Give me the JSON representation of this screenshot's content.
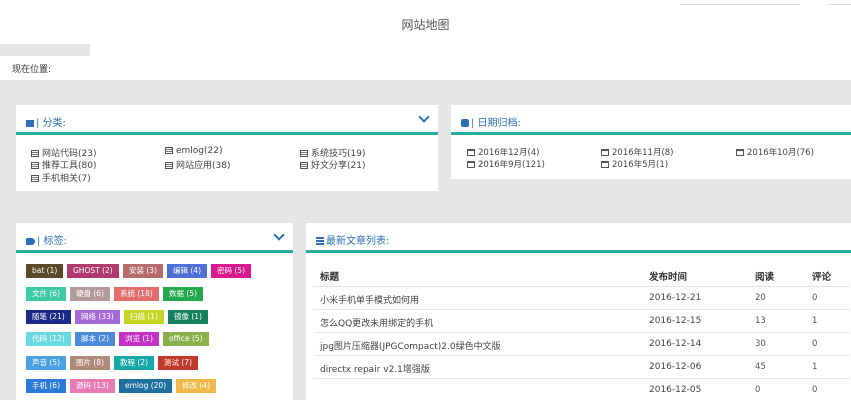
{
  "header": {
    "title": "网站地图"
  },
  "location": {
    "label": "现在位置:"
  },
  "categories_panel": {
    "title": "| 分类:",
    "items": [
      "网站代码(23)",
      "emlog(22)",
      "系统技巧(19)",
      "推荐工具(80)",
      "网站应用(38)",
      "好文分享(21)",
      "手机相关(7)"
    ]
  },
  "archive_panel": {
    "title": "| 日期归档:",
    "items": [
      "2016年12月(4)",
      "2016年11月(8)",
      "2016年10月(76)",
      "2016年9月(121)",
      "2016年5月(1)"
    ]
  },
  "tags_panel": {
    "title": "| 标签:",
    "tags": [
      {
        "label": "bat (1)",
        "color": "#5a4a2a"
      },
      {
        "label": "GHOST (2)",
        "color": "#b03a6e"
      },
      {
        "label": "安装 (3)",
        "color": "#b76b6b"
      },
      {
        "label": "编辑 (4)",
        "color": "#4f6fd8"
      },
      {
        "label": "密码 (5)",
        "color": "#d91a8e"
      },
      {
        "label": "文件 (6)",
        "color": "#3fc8a4"
      },
      {
        "label": "硬盘 (6)",
        "color": "#b59a9a"
      },
      {
        "label": "系统 (18)",
        "color": "#e36c6c"
      },
      {
        "label": "数据 (5)",
        "color": "#23a84e"
      },
      {
        "label": "随笔 (21)",
        "color": "#1b2a8a"
      },
      {
        "label": "网络 (33)",
        "color": "#a56ad8"
      },
      {
        "label": "扫描 (1)",
        "color": "#c6d424"
      },
      {
        "label": "镜像 (1)",
        "color": "#17805e"
      },
      {
        "label": "代码 (12)",
        "color": "#6ad8e0"
      },
      {
        "label": "脚本 (2)",
        "color": "#4a8ad8"
      },
      {
        "label": "浏览 (1)",
        "color": "#c431c4"
      },
      {
        "label": "office (5)",
        "color": "#8ab04a"
      },
      {
        "label": "声音 (5)",
        "color": "#4aa0e0"
      },
      {
        "label": "图片 (8)",
        "color": "#b08a7a"
      },
      {
        "label": "教程 (2)",
        "color": "#17a8a8"
      },
      {
        "label": "测试 (7)",
        "color": "#c0392b"
      },
      {
        "label": "手机 (6)",
        "color": "#2a7ad8"
      },
      {
        "label": "源码 (13)",
        "color": "#e87ab4"
      },
      {
        "label": "emlog (20)",
        "color": "#1f6fa0"
      },
      {
        "label": "修改 (4)",
        "color": "#f0b84a"
      }
    ]
  },
  "articles_panel": {
    "title": "最新文章列表:",
    "columns": [
      "标题",
      "发布时间",
      "阅读",
      "评论"
    ],
    "rows": [
      {
        "title": "小米手机单手模式如何用",
        "date": "2016-12-21",
        "reads": "20",
        "comments": "0"
      },
      {
        "title": "怎么QQ更改未用绑定的手机",
        "date": "2016-12-15",
        "reads": "13",
        "comments": "1"
      },
      {
        "title": "jpg图片压缩器(JPGCompact)2.0绿色中文版",
        "date": "2016-12-14",
        "reads": "30",
        "comments": "0"
      },
      {
        "title": "directx repair v2.1增强版",
        "date": "2016-12-06",
        "reads": "45",
        "comments": "1"
      },
      {
        "title": "",
        "date": "2016-12-05",
        "reads": "0",
        "comments": "0"
      }
    ]
  },
  "colors": {
    "accent": "#27ae9c",
    "title_blue": "#2c6fb7"
  }
}
